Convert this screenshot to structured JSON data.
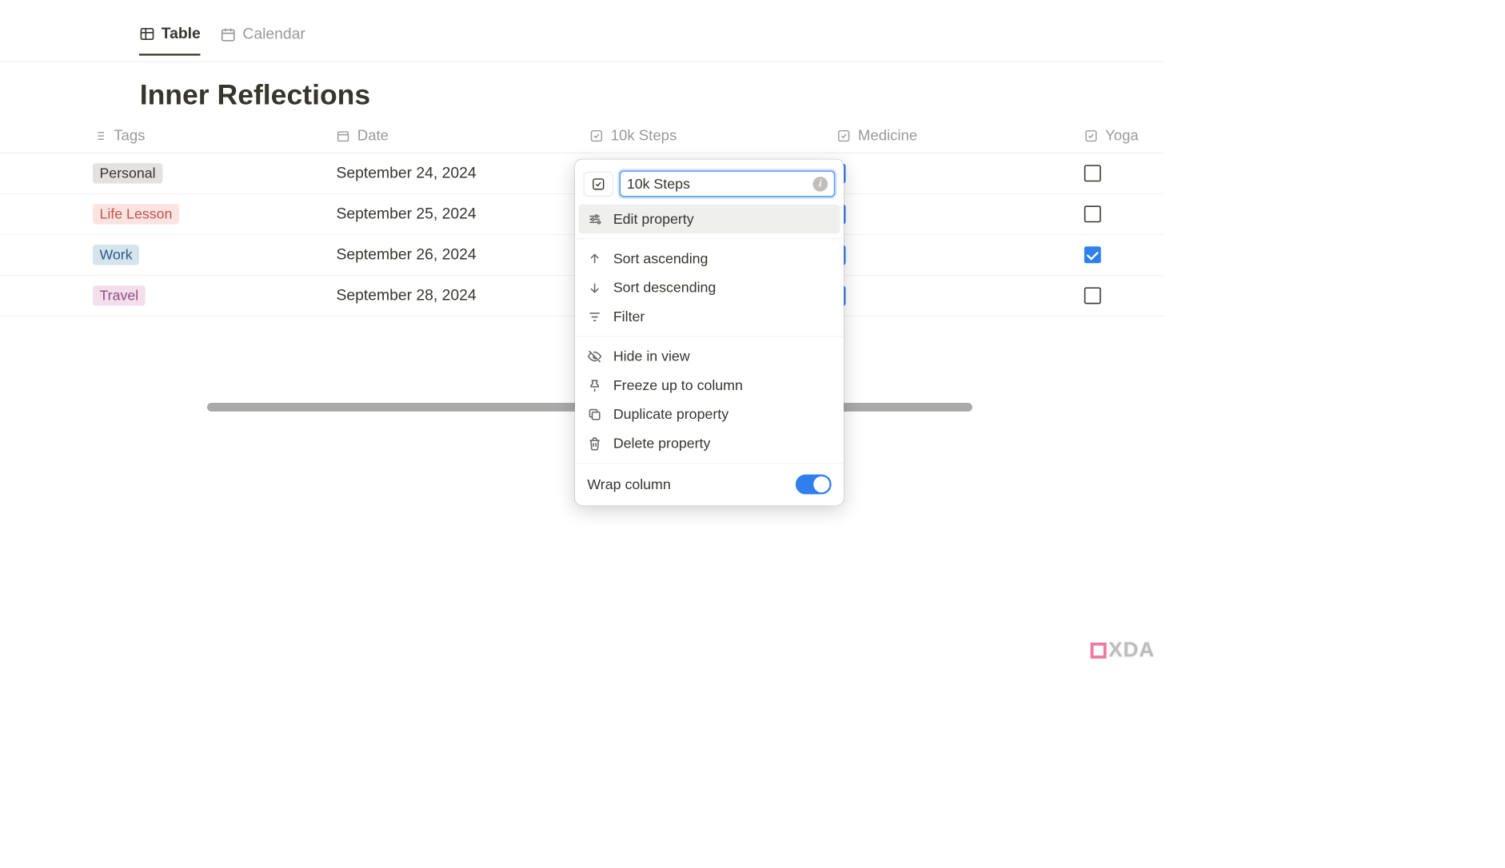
{
  "tabs": {
    "table": "Table",
    "calendar": "Calendar"
  },
  "title": "Inner Reflections",
  "columns": {
    "tags": "Tags",
    "date": "Date",
    "steps": "10k Steps",
    "medicine": "Medicine",
    "yoga": "Yoga"
  },
  "rows": [
    {
      "tag": "Personal",
      "tagClass": "tag-personal",
      "date": "September 24, 2024",
      "yoga": false
    },
    {
      "tag": "Life Lesson",
      "tagClass": "tag-life",
      "date": "September 25, 2024",
      "yoga": false
    },
    {
      "tag": "Work",
      "tagClass": "tag-work",
      "date": "September 26, 2024",
      "yoga": true
    },
    {
      "tag": "Travel",
      "tagClass": "tag-travel",
      "date": "September 28, 2024",
      "yoga": false
    }
  ],
  "popup": {
    "rename_value": "10k Steps",
    "edit_property": "Edit property",
    "sort_asc": "Sort ascending",
    "sort_desc": "Sort descending",
    "filter": "Filter",
    "hide": "Hide in view",
    "freeze": "Freeze up to column",
    "duplicate": "Duplicate property",
    "delete": "Delete property",
    "wrap": "Wrap column",
    "wrap_on": true
  },
  "watermark": "XDA"
}
